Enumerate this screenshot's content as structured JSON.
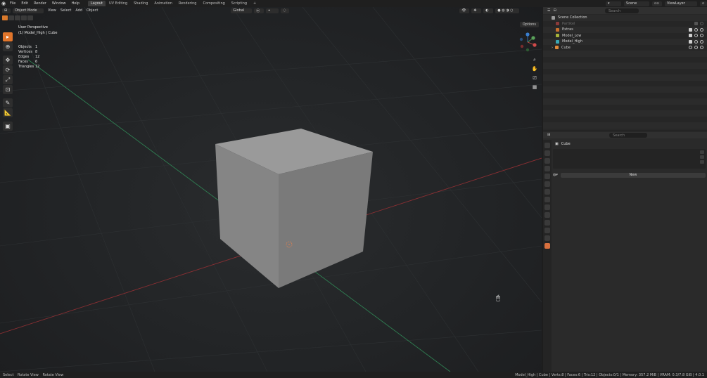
{
  "topbar": {
    "menus": [
      "File",
      "Edit",
      "Render",
      "Window",
      "Help"
    ],
    "tabs": [
      "Layout",
      "UV Editing",
      "Shading",
      "Animation",
      "Rendering",
      "Compositing",
      "Scripting"
    ],
    "active_tab": "Layout",
    "scene": "Scene",
    "view_layer": "ViewLayer"
  },
  "viewport": {
    "mode": "Object Mode",
    "menus": [
      "View",
      "Select",
      "Add",
      "Object"
    ],
    "transform": "Global",
    "options": "Options",
    "view_name": "User Perspective",
    "active_object": "(1) Model_High | Cube",
    "stats": [
      {
        "label": "Objects",
        "value": "1"
      },
      {
        "label": "Vertices",
        "value": "8"
      },
      {
        "label": "Edges",
        "value": "12"
      },
      {
        "label": "Faces",
        "value": "6"
      },
      {
        "label": "Triangles",
        "value": "12"
      }
    ],
    "colors": {
      "background": "#232527",
      "grid_x": "#8a2f33",
      "grid_y": "#2f7f52",
      "cube": "#8f8f8f",
      "accent": "#e1752b"
    }
  },
  "outliner": {
    "search_placeholder": "Search",
    "rows": [
      {
        "label": "Scene Collection",
        "dim": false
      },
      {
        "label": "Partikel",
        "dim": true
      },
      {
        "label": "Extras",
        "dim": false
      },
      {
        "label": "Model_Low",
        "dim": false
      },
      {
        "label": "Model_High",
        "dim": false
      },
      {
        "label": "Cube",
        "dim": false
      }
    ]
  },
  "properties": {
    "search_placeholder": "Search",
    "object_name": "Cube",
    "new_button": "New"
  },
  "statusbar": {
    "left": [
      "Select",
      "Rotate View",
      "Rotate View"
    ],
    "right": "Model_High | Cube | Verts:8 | Faces:6 | Tris:12 | Objects:0/1 | Memory: 357.2 MiB | VRAM: 0.3/7.8 GiB | 4.0.1"
  }
}
